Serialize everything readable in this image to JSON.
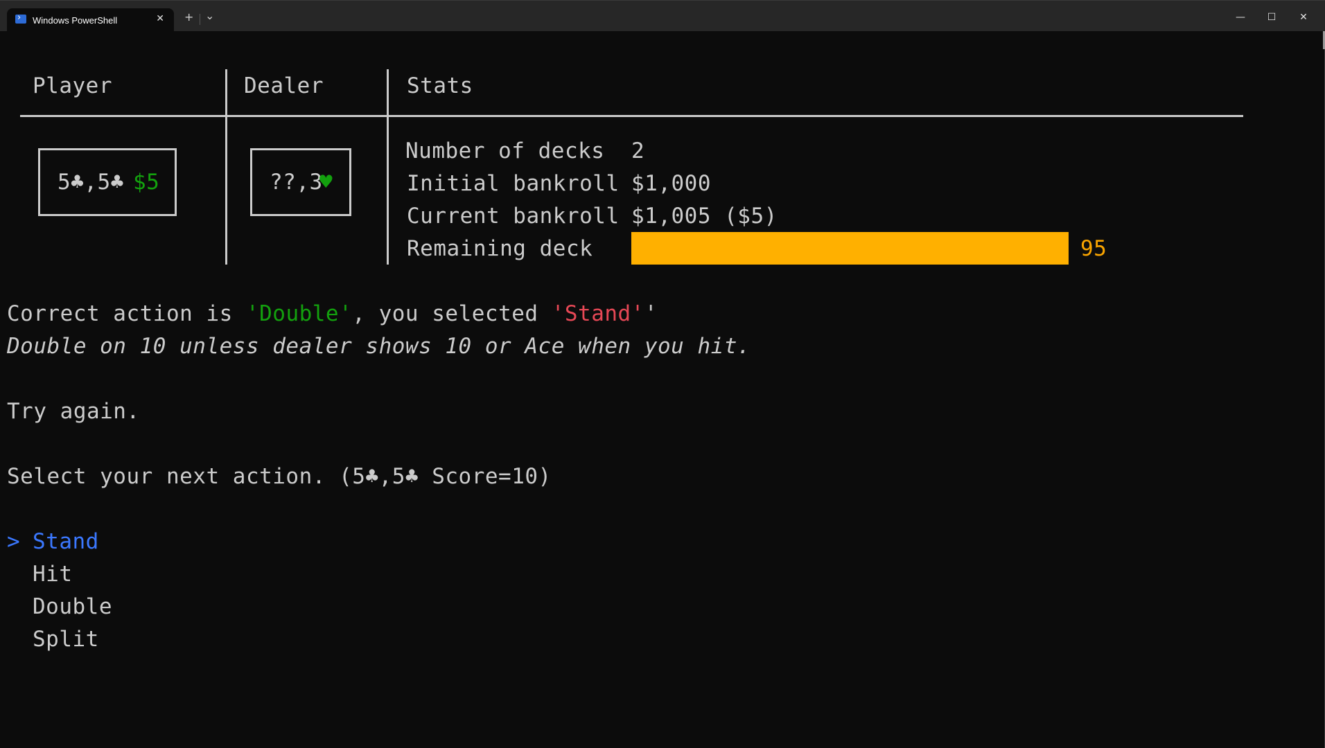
{
  "window": {
    "tab_title": "Windows PowerShell",
    "tab_close": "✕",
    "new_tab": "+",
    "tab_dropdown": "⌄",
    "minimize": "—",
    "maximize": "☐",
    "close": "✕"
  },
  "table": {
    "headers": {
      "player": "Player",
      "dealer": "Dealer",
      "stats": "Stats"
    },
    "player_card": {
      "hand": "5♣,5♣",
      "bet": "$5"
    },
    "dealer_card": {
      "hand": "??,3",
      "suit": "♥"
    },
    "stats": {
      "decks_label": "Number of decks",
      "decks_value": "2",
      "initial_label": "Initial bankroll",
      "initial_value": "$1,000",
      "current_label": "Current bankroll",
      "current_value": "$1,005 ($5)",
      "remaining_label": "Remaining deck",
      "remaining_value": "95",
      "remaining_fraction": 1.0
    }
  },
  "feedback": {
    "line1_prefix": "Correct action is ",
    "correct_action": "'Double'",
    "line1_middle": ", you selected ",
    "selected_action": "'Stand'",
    "line1_suffix": "'",
    "hint": "Double on 10 unless dealer shows 10 or Ace when you hit.",
    "retry": "Try again."
  },
  "prompt": "Select your next action. (5♣,5♣ Score=10)",
  "menu": {
    "cursor": ">",
    "options": [
      "Stand",
      "Hit",
      "Double",
      "Split"
    ],
    "selected_index": 0
  },
  "colors": {
    "background": "#0c0c0c",
    "text": "#cccccc",
    "green": "#13a10e",
    "red": "#e74856",
    "blue": "#3b78ff",
    "deck_bar": "#ffb000",
    "deck_number": "#f9a400"
  }
}
